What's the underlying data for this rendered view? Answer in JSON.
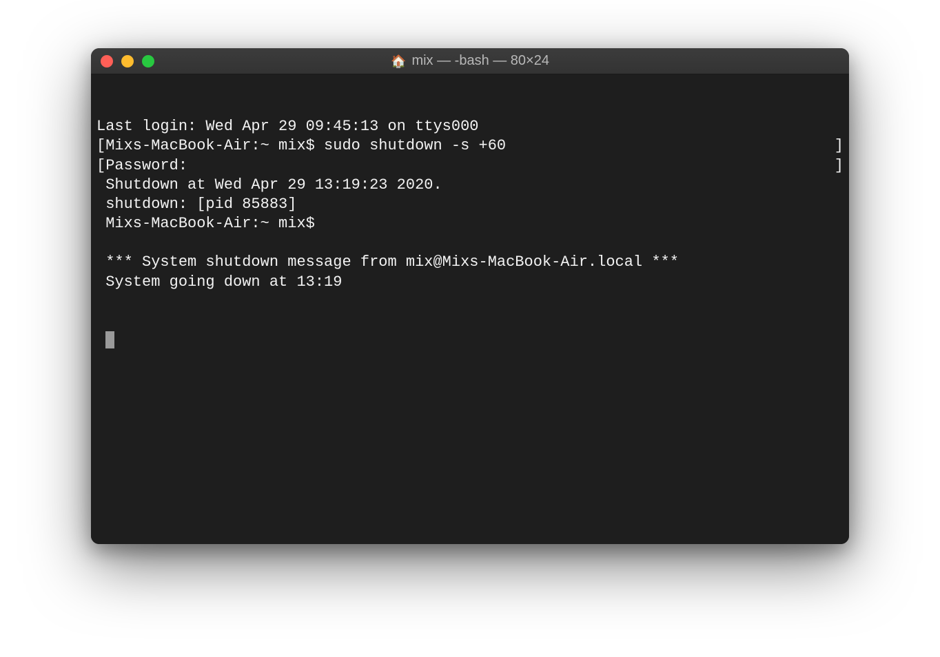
{
  "window": {
    "title": "mix — -bash — 80×24",
    "home_icon": "🏠"
  },
  "terminal": {
    "lines": [
      {
        "type": "plain",
        "text": "Last login: Wed Apr 29 09:45:13 on ttys000"
      },
      {
        "type": "bracket",
        "left": "[Mixs-MacBook-Air:~ mix$ sudo shutdown -s +60",
        "right": "]"
      },
      {
        "type": "bracket",
        "left": "[Password:",
        "right": "]"
      },
      {
        "type": "plain",
        "text": " Shutdown at Wed Apr 29 13:19:23 2020."
      },
      {
        "type": "plain",
        "text": " shutdown: [pid 85883]"
      },
      {
        "type": "plain",
        "text": " Mixs-MacBook-Air:~ mix$"
      },
      {
        "type": "plain",
        "text": ""
      },
      {
        "type": "plain",
        "text": " *** System shutdown message from mix@Mixs-MacBook-Air.local ***"
      },
      {
        "type": "plain",
        "text": " System going down at 13:19"
      },
      {
        "type": "plain",
        "text": ""
      },
      {
        "type": "plain",
        "text": ""
      },
      {
        "type": "cursor"
      }
    ]
  }
}
